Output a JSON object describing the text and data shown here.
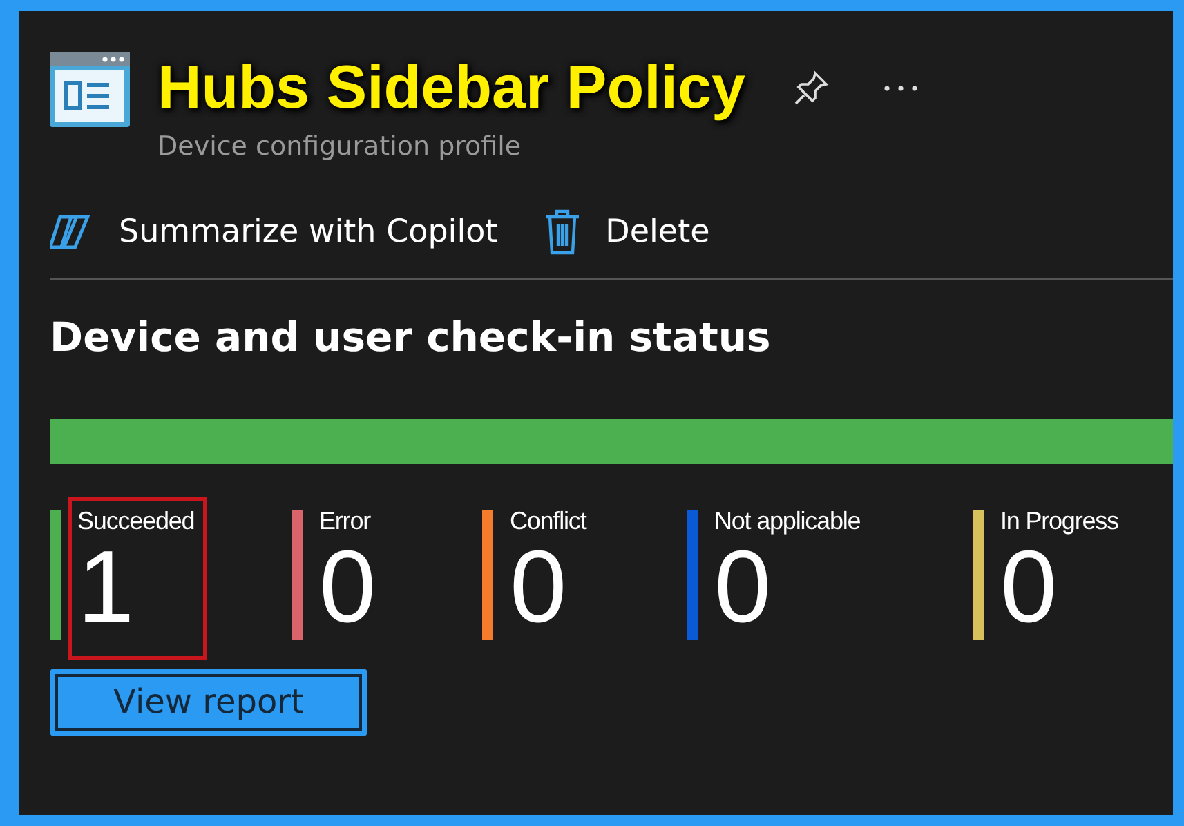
{
  "header": {
    "title": "Hubs Sidebar Policy",
    "subtitle": "Device configuration profile"
  },
  "toolbar": [
    {
      "label": "Summarize with Copilot",
      "kind": "copilot"
    },
    {
      "label": "Delete",
      "kind": "delete"
    }
  ],
  "status": {
    "heading": "Device and user check-in status",
    "bar": {
      "level": 1,
      "color": "#4caf50"
    },
    "stats": [
      {
        "label": "Succeeded",
        "count": "1",
        "color": "#4caf50",
        "highlighted": true
      },
      {
        "label": "Error",
        "count": "0",
        "color": "#d9646c",
        "highlighted": false
      },
      {
        "label": "Conflict",
        "count": "0",
        "color": "#f47c2c",
        "highlighted": false
      },
      {
        "label": "Not applicable",
        "count": "0",
        "color": "#0a5ad8",
        "highlighted": false
      },
      {
        "label": "In Progress",
        "count": "0",
        "color": "#d8c05c",
        "highlighted": false
      }
    ],
    "button": "View report"
  }
}
